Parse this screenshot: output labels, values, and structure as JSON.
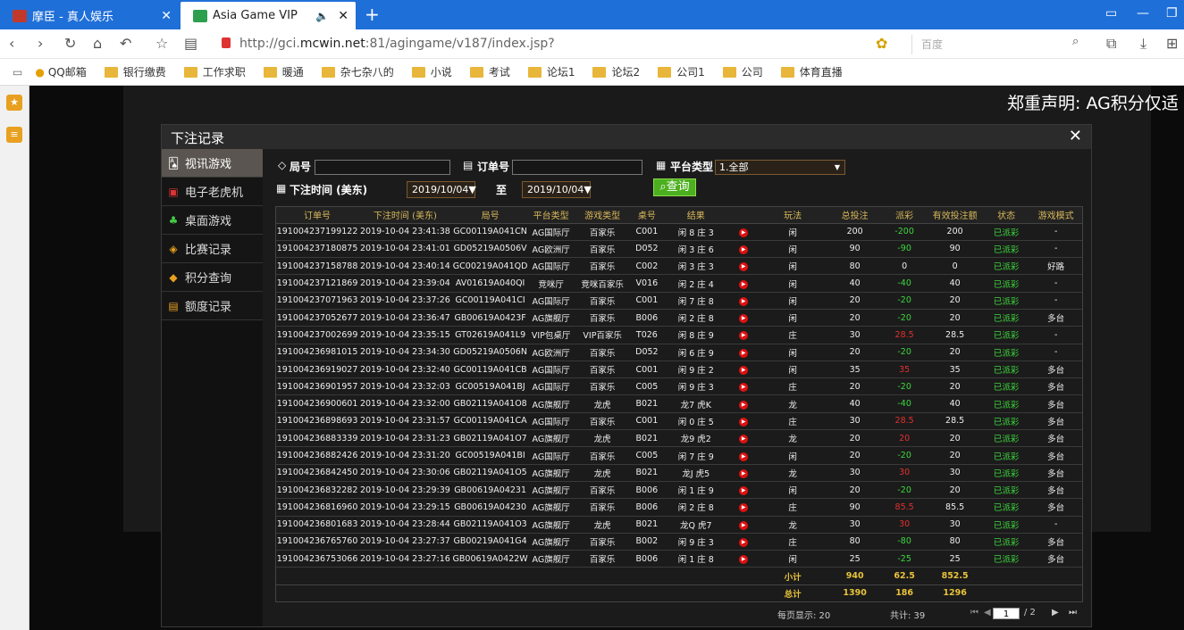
{
  "browser": {
    "tabs": [
      {
        "label": "摩臣 - 真人娱乐"
      },
      {
        "label": "Asia Game VIP"
      }
    ],
    "url_prefix": "http://gci.",
    "url_host": "mcwin.net",
    "url_suffix": ":81/agingame/v187/index.jsp?",
    "search_placeholder": "百度"
  },
  "bookmarks": [
    {
      "label": "QQ邮箱",
      "type": "link"
    },
    {
      "label": "银行缴费",
      "type": "folder"
    },
    {
      "label": "工作求职",
      "type": "folder"
    },
    {
      "label": "暖通",
      "type": "folder"
    },
    {
      "label": "杂七杂八的",
      "type": "folder"
    },
    {
      "label": "小说",
      "type": "folder"
    },
    {
      "label": "考试",
      "type": "folder"
    },
    {
      "label": "论坛1",
      "type": "folder"
    },
    {
      "label": "论坛2",
      "type": "folder"
    },
    {
      "label": "公司1",
      "type": "folder"
    },
    {
      "label": "公司",
      "type": "folder"
    },
    {
      "label": "体育直播",
      "type": "folder"
    }
  ],
  "game": {
    "declaration": "郑重声明: AG积分仅适"
  },
  "modal": {
    "title": "下注记录",
    "menu": [
      {
        "label": "视讯游戏",
        "icon": "cards-icon"
      },
      {
        "label": "电子老虎机",
        "icon": "slot-icon"
      },
      {
        "label": "桌面游戏",
        "icon": "table-icon"
      },
      {
        "label": "比赛记录",
        "icon": "ticket-icon"
      },
      {
        "label": "积分查询",
        "icon": "diamond-icon"
      },
      {
        "label": "额度记录",
        "icon": "document-icon"
      }
    ],
    "filters": {
      "round_label": "局号",
      "order_label": "订单号",
      "platform_label": "平台类型",
      "platform_value": "1.全部",
      "time_label": "下注时间 (美东)",
      "date_from": "2019/10/04▼",
      "to_label": "至",
      "date_to": "2019/10/04▼",
      "query_label": "查询"
    },
    "table": {
      "headers": [
        "订单号",
        "下注时间 (美东)",
        "局号",
        "平台类型",
        "游戏类型",
        "桌号",
        "结果",
        "",
        "玩法",
        "总投注",
        "派彩",
        "有效投注额",
        "状态",
        "游戏模式"
      ],
      "rows": [
        [
          "191004237199122",
          "2019-10-04 23:41:38",
          "GC00119A041CN",
          "AG国际厅",
          "百家乐",
          "C001",
          "闲 8 庄 3",
          "闲",
          "200",
          "-200",
          "200",
          "已派彩",
          "-"
        ],
        [
          "191004237180875",
          "2019-10-04 23:41:01",
          "GD05219A0506V",
          "AG欧洲厅",
          "百家乐",
          "D052",
          "闲 3 庄 6",
          "闲",
          "90",
          "-90",
          "90",
          "已派彩",
          "-"
        ],
        [
          "191004237158788",
          "2019-10-04 23:40:14",
          "GC00219A041QD",
          "AG国际厅",
          "百家乐",
          "C002",
          "闲 3 庄 3",
          "闲",
          "80",
          "0",
          "0",
          "已派彩",
          "好路"
        ],
        [
          "191004237121869",
          "2019-10-04 23:39:04",
          "AV01619A040QI",
          "竞咪厅",
          "竞咪百家乐",
          "V016",
          "闲 2 庄 4",
          "闲",
          "40",
          "-40",
          "40",
          "已派彩",
          "-"
        ],
        [
          "191004237071963",
          "2019-10-04 23:37:26",
          "GC00119A041CI",
          "AG国际厅",
          "百家乐",
          "C001",
          "闲 7 庄 8",
          "闲",
          "20",
          "-20",
          "20",
          "已派彩",
          "-"
        ],
        [
          "191004237052677",
          "2019-10-04 23:36:47",
          "GB00619A0423F",
          "AG旗舰厅",
          "百家乐",
          "B006",
          "闲 2 庄 8",
          "闲",
          "20",
          "-20",
          "20",
          "已派彩",
          "多台"
        ],
        [
          "191004237002699",
          "2019-10-04 23:35:15",
          "GT02619A041L9",
          "VIP包桌厅",
          "VIP百家乐",
          "T026",
          "闲 8 庄 9",
          "庄",
          "30",
          "28.5",
          "28.5",
          "已派彩",
          "-"
        ],
        [
          "191004236981015",
          "2019-10-04 23:34:30",
          "GD05219A0506N",
          "AG欧洲厅",
          "百家乐",
          "D052",
          "闲 6 庄 9",
          "闲",
          "20",
          "-20",
          "20",
          "已派彩",
          "-"
        ],
        [
          "191004236919027",
          "2019-10-04 23:32:40",
          "GC00119A041CB",
          "AG国际厅",
          "百家乐",
          "C001",
          "闲 9 庄 2",
          "闲",
          "35",
          "35",
          "35",
          "已派彩",
          "多台"
        ],
        [
          "191004236901957",
          "2019-10-04 23:32:03",
          "GC00519A041BJ",
          "AG国际厅",
          "百家乐",
          "C005",
          "闲 9 庄 3",
          "庄",
          "20",
          "-20",
          "20",
          "已派彩",
          "多台"
        ],
        [
          "191004236900601",
          "2019-10-04 23:32:00",
          "GB02119A041O8",
          "AG旗舰厅",
          "龙虎",
          "B021",
          "龙7 虎K",
          "龙",
          "40",
          "-40",
          "40",
          "已派彩",
          "多台"
        ],
        [
          "191004236898693",
          "2019-10-04 23:31:57",
          "GC00119A041CA",
          "AG国际厅",
          "百家乐",
          "C001",
          "闲 0 庄 5",
          "庄",
          "30",
          "28.5",
          "28.5",
          "已派彩",
          "多台"
        ],
        [
          "191004236883339",
          "2019-10-04 23:31:23",
          "GB02119A041O7",
          "AG旗舰厅",
          "龙虎",
          "B021",
          "龙9 虎2",
          "龙",
          "20",
          "20",
          "20",
          "已派彩",
          "多台"
        ],
        [
          "191004236882426",
          "2019-10-04 23:31:20",
          "GC00519A041BI",
          "AG国际厅",
          "百家乐",
          "C005",
          "闲 7 庄 9",
          "闲",
          "20",
          "-20",
          "20",
          "已派彩",
          "多台"
        ],
        [
          "191004236842450",
          "2019-10-04 23:30:06",
          "GB02119A041O5",
          "AG旗舰厅",
          "龙虎",
          "B021",
          "龙J 虎5",
          "龙",
          "30",
          "30",
          "30",
          "已派彩",
          "多台"
        ],
        [
          "191004236832282",
          "2019-10-04 23:29:39",
          "GB00619A04231",
          "AG旗舰厅",
          "百家乐",
          "B006",
          "闲 1 庄 9",
          "闲",
          "20",
          "-20",
          "20",
          "已派彩",
          "多台"
        ],
        [
          "191004236816960",
          "2019-10-04 23:29:15",
          "GB00619A04230",
          "AG旗舰厅",
          "百家乐",
          "B006",
          "闲 2 庄 8",
          "庄",
          "90",
          "85.5",
          "85.5",
          "已派彩",
          "多台"
        ],
        [
          "191004236801683",
          "2019-10-04 23:28:44",
          "GB02119A041O3",
          "AG旗舰厅",
          "龙虎",
          "B021",
          "龙Q 虎7",
          "龙",
          "30",
          "30",
          "30",
          "已派彩",
          "-"
        ],
        [
          "191004236765760",
          "2019-10-04 23:27:37",
          "GB00219A041G4",
          "AG旗舰厅",
          "百家乐",
          "B002",
          "闲 9 庄 3",
          "庄",
          "80",
          "-80",
          "80",
          "已派彩",
          "多台"
        ],
        [
          "191004236753066",
          "2019-10-04 23:27:16",
          "GB00619A0422W",
          "AG旗舰厅",
          "百家乐",
          "B006",
          "闲 1 庄 8",
          "闲",
          "25",
          "-25",
          "25",
          "已派彩",
          "多台"
        ]
      ],
      "subtotal": {
        "label": "小计",
        "bet": "940",
        "payout": "62.5",
        "valid": "852.5"
      },
      "total": {
        "label": "总计",
        "bet": "1390",
        "payout": "186",
        "valid": "1296"
      }
    },
    "pager": {
      "per_page": "每页显示: 20",
      "count": "共计: 39",
      "page": "1",
      "pages": "/ 2"
    }
  }
}
